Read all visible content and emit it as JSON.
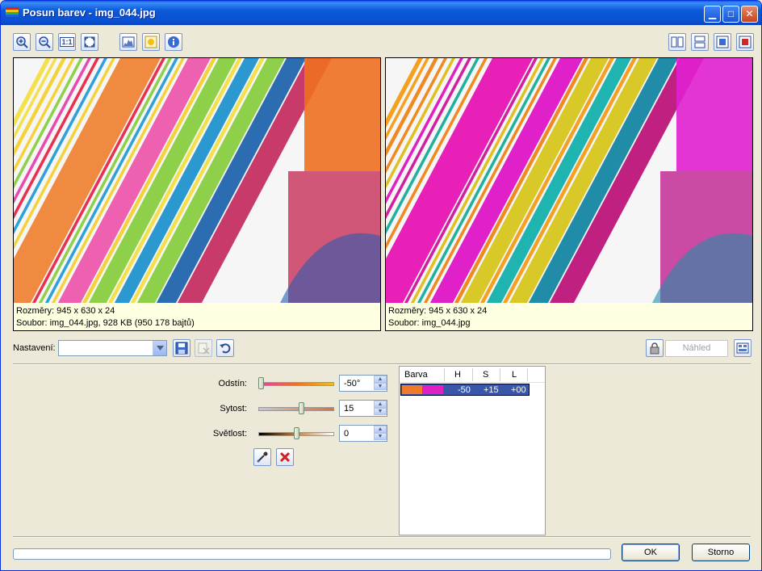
{
  "window": {
    "title": "Posun barev - img_044.jpg",
    "controls": [
      "minimize-icon",
      "maximize-icon",
      "close-icon"
    ]
  },
  "toolbar": {
    "left_icons": [
      "zoom-in-icon",
      "zoom-out-icon",
      "actual-size-icon",
      "fit-to-window-icon",
      "histogram-icon",
      "highlight-icon",
      "info-icon"
    ],
    "actual_size_label": "1:1",
    "right_icons": [
      "split-vertical-icon",
      "split-horizontal-icon",
      "original-only-icon",
      "result-only-icon"
    ]
  },
  "panels": {
    "original": {
      "dimensions": "Rozměry: 945 x 630 x 24",
      "file": "Soubor: img_044.jpg, 928 KB (950 178 bajtů)"
    },
    "result": {
      "dimensions": "Rozměry: 945 x 630 x 24",
      "file": "Soubor: img_044.jpg"
    }
  },
  "settings": {
    "label": "Nastavení:",
    "value": "",
    "preview_label": "Náhled"
  },
  "adjustments": {
    "hue": {
      "label": "Odstín:",
      "value": "-50°",
      "level": 0.0
    },
    "saturation": {
      "label": "Sytost:",
      "value": "15",
      "level": 0.57
    },
    "lightness": {
      "label": "Světlost:",
      "value": "0",
      "level": 0.5
    }
  },
  "color_table": {
    "headers": {
      "color": "Barva",
      "h": "H",
      "s": "S",
      "l": "L"
    },
    "rows": [
      {
        "from_color": "#f07a2a",
        "to_color": "#e020c0",
        "h": "-50",
        "s": "+15",
        "l": "+00"
      }
    ]
  },
  "footer": {
    "progress": 0,
    "ok_label": "OK",
    "cancel_label": "Storno"
  },
  "colors": {
    "titlebar": "#0a4fcf",
    "info_background": "#ffffe1",
    "selection": "#3a56a8"
  }
}
